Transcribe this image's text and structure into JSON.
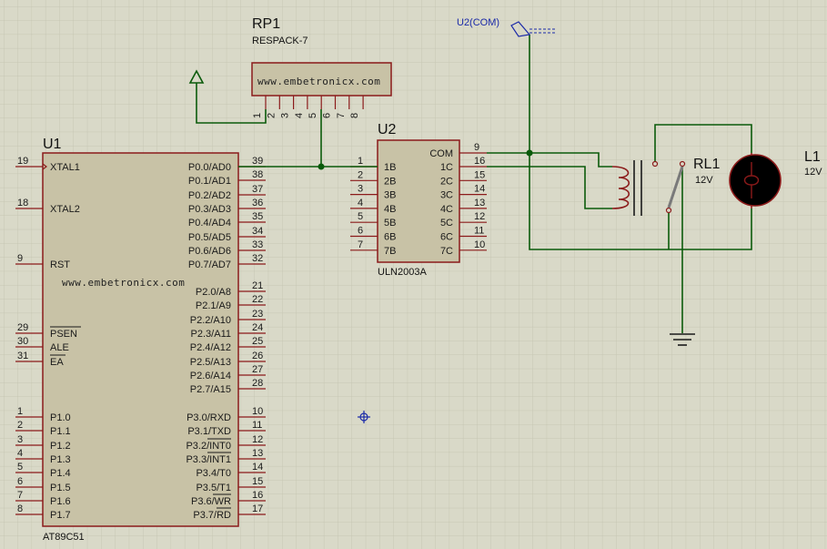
{
  "colors": {
    "background": "#d9d9c8",
    "grid": "#c6c6b3",
    "component_body": "#c8c2a6",
    "component_outline": "#8b1a1a",
    "wire": "#0a5a0a",
    "junction": "#0a5a0a",
    "terminal_text": "#1b2aa8",
    "text": "#1a1a1a"
  },
  "u1": {
    "ref": "U1",
    "part": "AT89C51",
    "watermark": "www.embetronicx.com",
    "left_pins": [
      {
        "num": "19",
        "label": "XTAL1"
      },
      {
        "num": "18",
        "label": "XTAL2"
      },
      {
        "num": "9",
        "label": "RST"
      },
      {
        "num": "29",
        "label": "PSEN"
      },
      {
        "num": "30",
        "label": "ALE"
      },
      {
        "num": "31",
        "label": "EA"
      },
      {
        "num": "1",
        "label": "P1.0"
      },
      {
        "num": "2",
        "label": "P1.1"
      },
      {
        "num": "3",
        "label": "P1.2"
      },
      {
        "num": "4",
        "label": "P1.3"
      },
      {
        "num": "5",
        "label": "P1.4"
      },
      {
        "num": "6",
        "label": "P1.5"
      },
      {
        "num": "7",
        "label": "P1.6"
      },
      {
        "num": "8",
        "label": "P1.7"
      }
    ],
    "right_pins": [
      {
        "num": "39",
        "label": "P0.0/AD0"
      },
      {
        "num": "38",
        "label": "P0.1/AD1"
      },
      {
        "num": "37",
        "label": "P0.2/AD2"
      },
      {
        "num": "36",
        "label": "P0.3/AD3"
      },
      {
        "num": "35",
        "label": "P0.4/AD4"
      },
      {
        "num": "34",
        "label": "P0.5/AD5"
      },
      {
        "num": "33",
        "label": "P0.6/AD6"
      },
      {
        "num": "32",
        "label": "P0.7/AD7"
      },
      {
        "num": "21",
        "label": "P2.0/A8"
      },
      {
        "num": "22",
        "label": "P2.1/A9"
      },
      {
        "num": "23",
        "label": "P2.2/A10"
      },
      {
        "num": "24",
        "label": "P2.3/A11"
      },
      {
        "num": "25",
        "label": "P2.4/A12"
      },
      {
        "num": "26",
        "label": "P2.5/A13"
      },
      {
        "num": "27",
        "label": "P2.6/A14"
      },
      {
        "num": "28",
        "label": "P2.7/A15"
      },
      {
        "num": "10",
        "label": "P3.0/RXD"
      },
      {
        "num": "11",
        "label": "P3.1/TXD"
      },
      {
        "num": "12",
        "label": "P3.2/INT0"
      },
      {
        "num": "13",
        "label": "P3.3/INT1"
      },
      {
        "num": "14",
        "label": "P3.4/T0"
      },
      {
        "num": "15",
        "label": "P3.5/T1"
      },
      {
        "num": "16",
        "label": "P3.6/WR"
      },
      {
        "num": "17",
        "label": "P3.7/RD"
      }
    ]
  },
  "rp1": {
    "ref": "RP1",
    "part": "RESPACK-7",
    "watermark": "www.embetronicx.com",
    "pins": [
      "1",
      "2",
      "3",
      "4",
      "5",
      "6",
      "7",
      "8"
    ]
  },
  "u2": {
    "ref": "U2",
    "part": "ULN2003A",
    "com_label": "COM",
    "com_pin": "9",
    "inputs": [
      {
        "num": "1",
        "label": "1B"
      },
      {
        "num": "2",
        "label": "2B"
      },
      {
        "num": "3",
        "label": "3B"
      },
      {
        "num": "4",
        "label": "4B"
      },
      {
        "num": "5",
        "label": "5B"
      },
      {
        "num": "6",
        "label": "6B"
      },
      {
        "num": "7",
        "label": "7B"
      }
    ],
    "outputs": [
      {
        "num": "16",
        "label": "1C"
      },
      {
        "num": "15",
        "label": "2C"
      },
      {
        "num": "14",
        "label": "3C"
      },
      {
        "num": "13",
        "label": "4C"
      },
      {
        "num": "12",
        "label": "5C"
      },
      {
        "num": "11",
        "label": "6C"
      },
      {
        "num": "10",
        "label": "7C"
      }
    ]
  },
  "terminal": {
    "label": "U2(COM)"
  },
  "rl1": {
    "ref": "RL1",
    "value": "12V"
  },
  "l1": {
    "ref": "L1",
    "value": "12V"
  }
}
